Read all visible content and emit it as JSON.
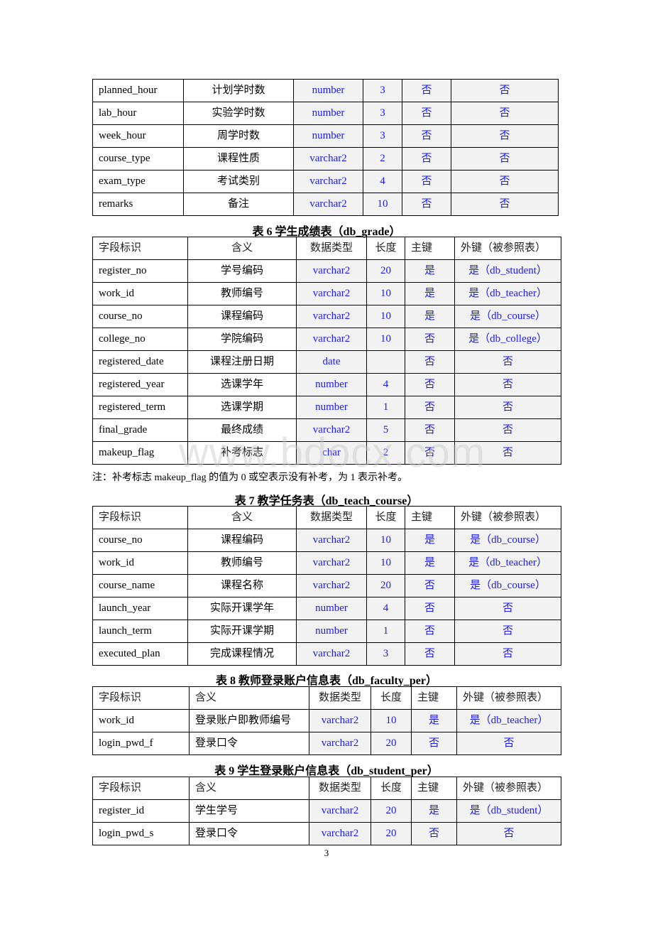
{
  "table5_tail": {
    "rows": [
      [
        "planned_hour",
        "计划学时数",
        "number",
        "3",
        "否",
        "否"
      ],
      [
        "lab_hour",
        "实验学时数",
        "number",
        "3",
        "否",
        "否"
      ],
      [
        "week_hour",
        "周学时数",
        "number",
        "3",
        "否",
        "否"
      ],
      [
        "course_type",
        "课程性质",
        "varchar2",
        "2",
        "否",
        "否"
      ],
      [
        "exam_type",
        "考试类别",
        "varchar2",
        "4",
        "否",
        "否"
      ],
      [
        "remarks",
        "备注",
        "varchar2",
        "10",
        "否",
        "否"
      ]
    ]
  },
  "table6": {
    "caption": "表 6  学生成绩表（db_grade）",
    "headers": [
      "字段标识",
      "含义",
      "数据类型",
      "长度",
      "主键",
      "外键（被参照表）"
    ],
    "rows": [
      [
        "register_no",
        "学号编码",
        "varchar2",
        "20",
        "是",
        "是（db_student）"
      ],
      [
        "work_id",
        "教师编号",
        "varchar2",
        "10",
        "是",
        "是（db_teacher）"
      ],
      [
        "course_no",
        "课程编码",
        "varchar2",
        "10",
        "是",
        "是（db_course）"
      ],
      [
        "college_no",
        "学院编码",
        "varchar2",
        "10",
        "否",
        "是（db_college）"
      ],
      [
        "registered_date",
        "课程注册日期",
        "date",
        "",
        "否",
        "否"
      ],
      [
        "registered_year",
        "选课学年",
        "number",
        "4",
        "否",
        "否"
      ],
      [
        "registered_term",
        "选课学期",
        "number",
        "1",
        "否",
        "否"
      ],
      [
        "final_grade",
        "最终成绩",
        "varchar2",
        "5",
        "否",
        "否"
      ],
      [
        "makeup_flag",
        "补考标志",
        "char",
        "2",
        "否",
        "否"
      ]
    ],
    "note": "注：补考标志 makeup_flag 的值为 0 或空表示没有补考，为 1 表示补考。"
  },
  "table7": {
    "caption": "表 7  教学任务表（db_teach_course）",
    "headers": [
      "字段标识",
      "含义",
      "数据类型",
      "长度",
      "主键",
      "外键（被参照表）"
    ],
    "rows": [
      [
        "course_no",
        "课程编码",
        "varchar2",
        "10",
        "是",
        "是（db_course）"
      ],
      [
        "work_id",
        "教师编号",
        "varchar2",
        "10",
        "是",
        "是（db_teacher）"
      ],
      [
        "course_name",
        "课程名称",
        "varchar2",
        "20",
        "否",
        "是（db_course）"
      ],
      [
        "launch_year",
        "实际开课学年",
        "number",
        "4",
        "否",
        "否"
      ],
      [
        "launch_term",
        "实际开课学期",
        "number",
        "1",
        "否",
        "否"
      ],
      [
        "executed_plan",
        "完成课程情况",
        "varchar2",
        "3",
        "否",
        "否"
      ]
    ]
  },
  "table8": {
    "caption": "表 8  教师登录账户信息表（db_faculty_per）",
    "headers": [
      "字段标识",
      "含义",
      "数据类型",
      "长度",
      "主键",
      "外键（被参照表）"
    ],
    "rows": [
      [
        "work_id",
        "登录账户即教师编号",
        "varchar2",
        "10",
        "是",
        "是（db_teacher）"
      ],
      [
        "login_pwd_f",
        "登录口令",
        "varchar2",
        "20",
        "否",
        "否"
      ]
    ]
  },
  "table9": {
    "caption": "表  9  学生登录账户信息表（db_student_per）",
    "headers": [
      "字段标识",
      "含义",
      "数据类型",
      "长度",
      "主键",
      "外键（被参照表）"
    ],
    "rows": [
      [
        "register_id",
        "学生学号",
        "varchar2",
        "20",
        "是",
        "是（db_student）"
      ],
      [
        "login_pwd_s",
        "登录口令",
        "varchar2",
        "20",
        "否",
        "否"
      ]
    ]
  },
  "watermark": "www.bdocx.com",
  "page_number": "3"
}
